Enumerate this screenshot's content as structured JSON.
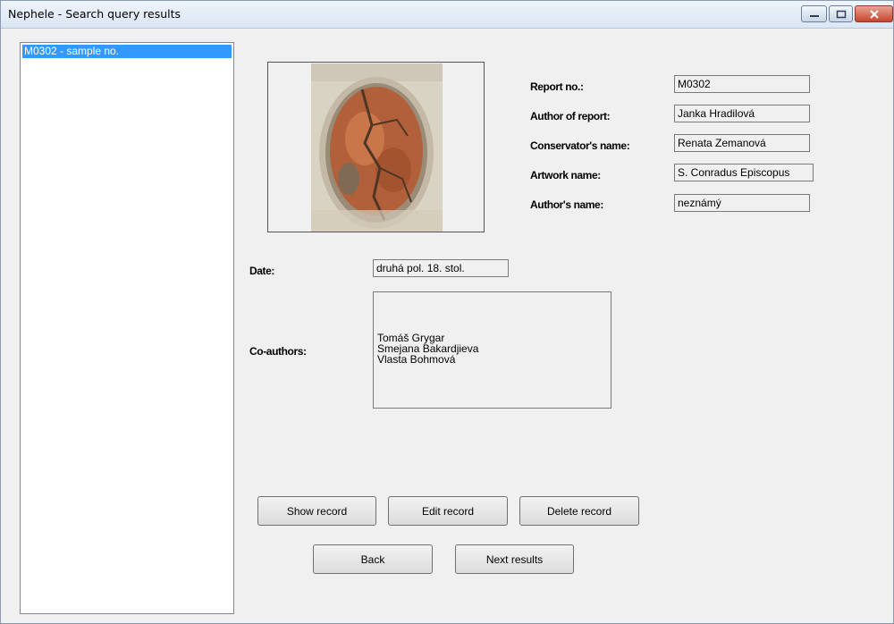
{
  "window": {
    "title": "Nephele - Search query results"
  },
  "results": {
    "items": [
      {
        "label": "M0302 - sample no."
      }
    ]
  },
  "details": {
    "report_no": {
      "label": "Report no.:",
      "value": "M0302"
    },
    "author_of_report": {
      "label": "Author of report:",
      "value": "Janka Hradilová"
    },
    "conservator_name": {
      "label": "Conservator's name:",
      "value": "Renata Zemanová"
    },
    "artwork_name": {
      "label": "Artwork name:",
      "value": "S. Conradus Episcopus"
    },
    "author_name": {
      "label": "Author's name:",
      "value": "neznámý"
    },
    "date": {
      "label": "Date:",
      "value": "druhá pol. 18. stol."
    },
    "coauthors": {
      "label": "Co-authors:",
      "names": [
        "Tomáš Grygar",
        "Smejana Bakardjieva",
        "Vlasta Bohmová"
      ]
    }
  },
  "buttons": {
    "show": "Show record",
    "edit": "Edit record",
    "delete": "Delete record",
    "back": "Back",
    "next": "Next results"
  },
  "icons": {
    "minimize": "minimize-icon",
    "maximize": "maximize-icon",
    "close": "close-icon"
  },
  "colors": {
    "selection": "#3399ff",
    "close_button": "#c7452b"
  }
}
